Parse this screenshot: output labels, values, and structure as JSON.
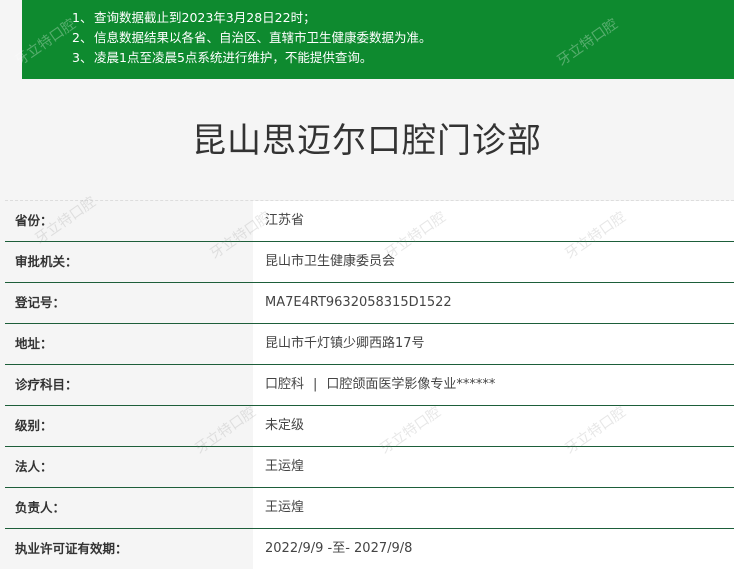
{
  "notice": {
    "lines": [
      {
        "num": "1、",
        "text": "查询数据截止到2023年3月28日22时；"
      },
      {
        "num": "2、",
        "text": "信息数据结果以各省、自治区、直辖市卫生健康委数据为准。"
      },
      {
        "num": "3、",
        "text": "凌晨1点至凌晨5点系统进行维护，不能提供查询。"
      }
    ]
  },
  "title": "昆山思迈尔口腔门诊部",
  "rows": [
    {
      "label": "省份：",
      "value": "江苏省"
    },
    {
      "label": "审批机关：",
      "value": "昆山市卫生健康委员会"
    },
    {
      "label": "登记号：",
      "value": "MA7E4RT9632058315D1522"
    },
    {
      "label": "地址：",
      "value": "昆山市千灯镇少卿西路17号"
    },
    {
      "label": "诊疗科目：",
      "value_parts": [
        "口腔科",
        "|",
        "口腔颌面医学影像专业******"
      ]
    },
    {
      "label": "级别：",
      "value": "未定级"
    },
    {
      "label": "法人：",
      "value": "王运煌"
    },
    {
      "label": "负责人：",
      "value": "王运煌"
    },
    {
      "label": "执业许可证有效期：",
      "value": "2022/9/9 -至- 2027/9/8"
    }
  ],
  "watermark": "牙立特口腔",
  "colors": {
    "notice_bg": "#0e8a2f",
    "row_border": "#1d5e3a",
    "page_bg": "#f5f5f5"
  }
}
